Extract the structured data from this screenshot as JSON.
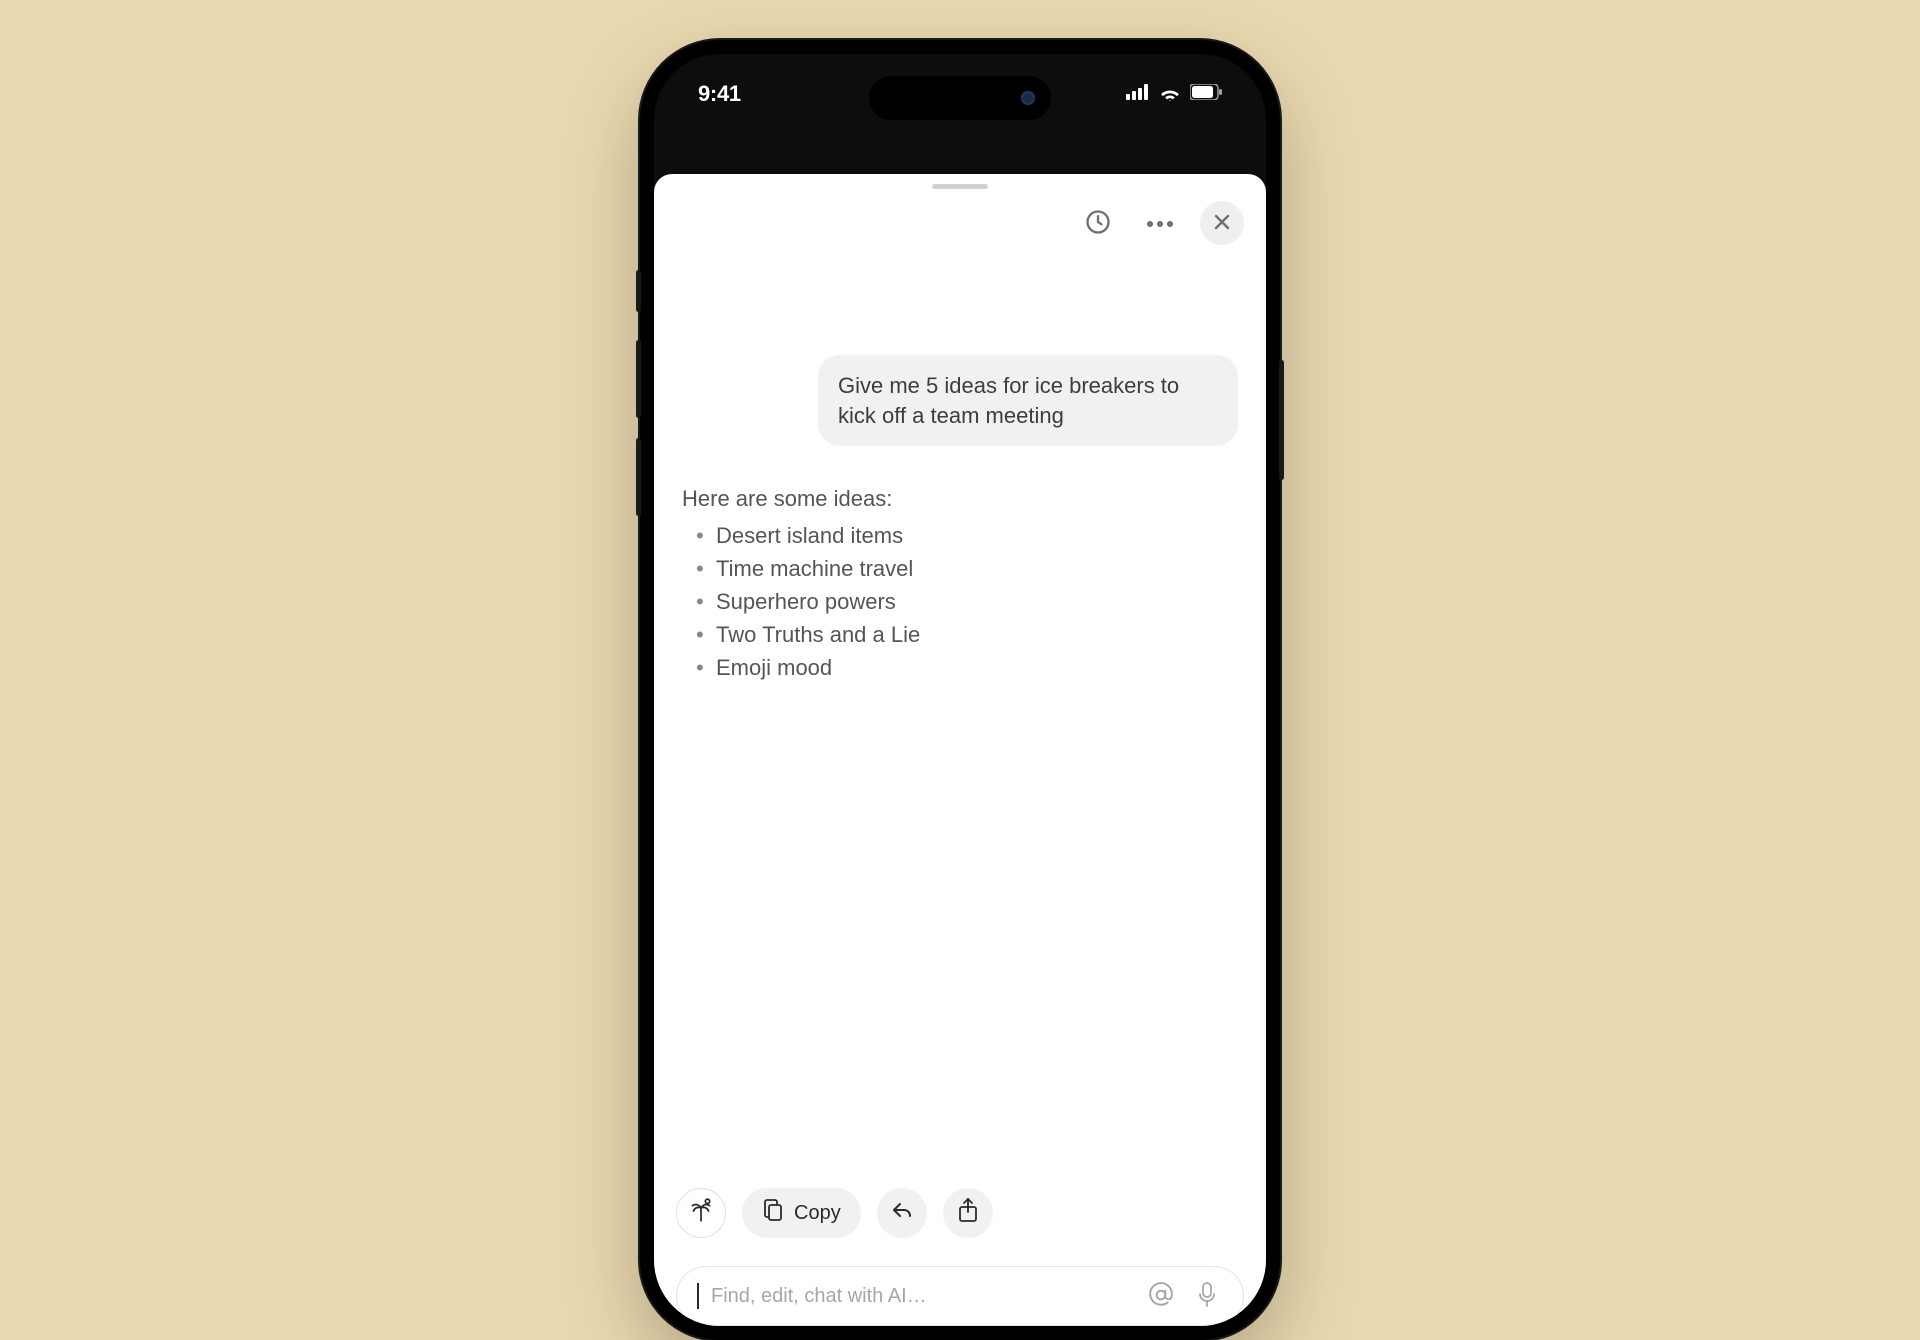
{
  "status": {
    "time": "9:41"
  },
  "chat": {
    "user_message": "Give me 5 ideas for ice breakers to kick off a team meeting",
    "ai_intro": "Here are some ideas:",
    "ai_items": [
      "Desert island items",
      "Time machine travel",
      "Superhero powers",
      "Two Truths and a Lie",
      "Emoji mood"
    ]
  },
  "actions": {
    "copy_label": "Copy"
  },
  "input": {
    "placeholder": "Find, edit, chat with AI…"
  }
}
